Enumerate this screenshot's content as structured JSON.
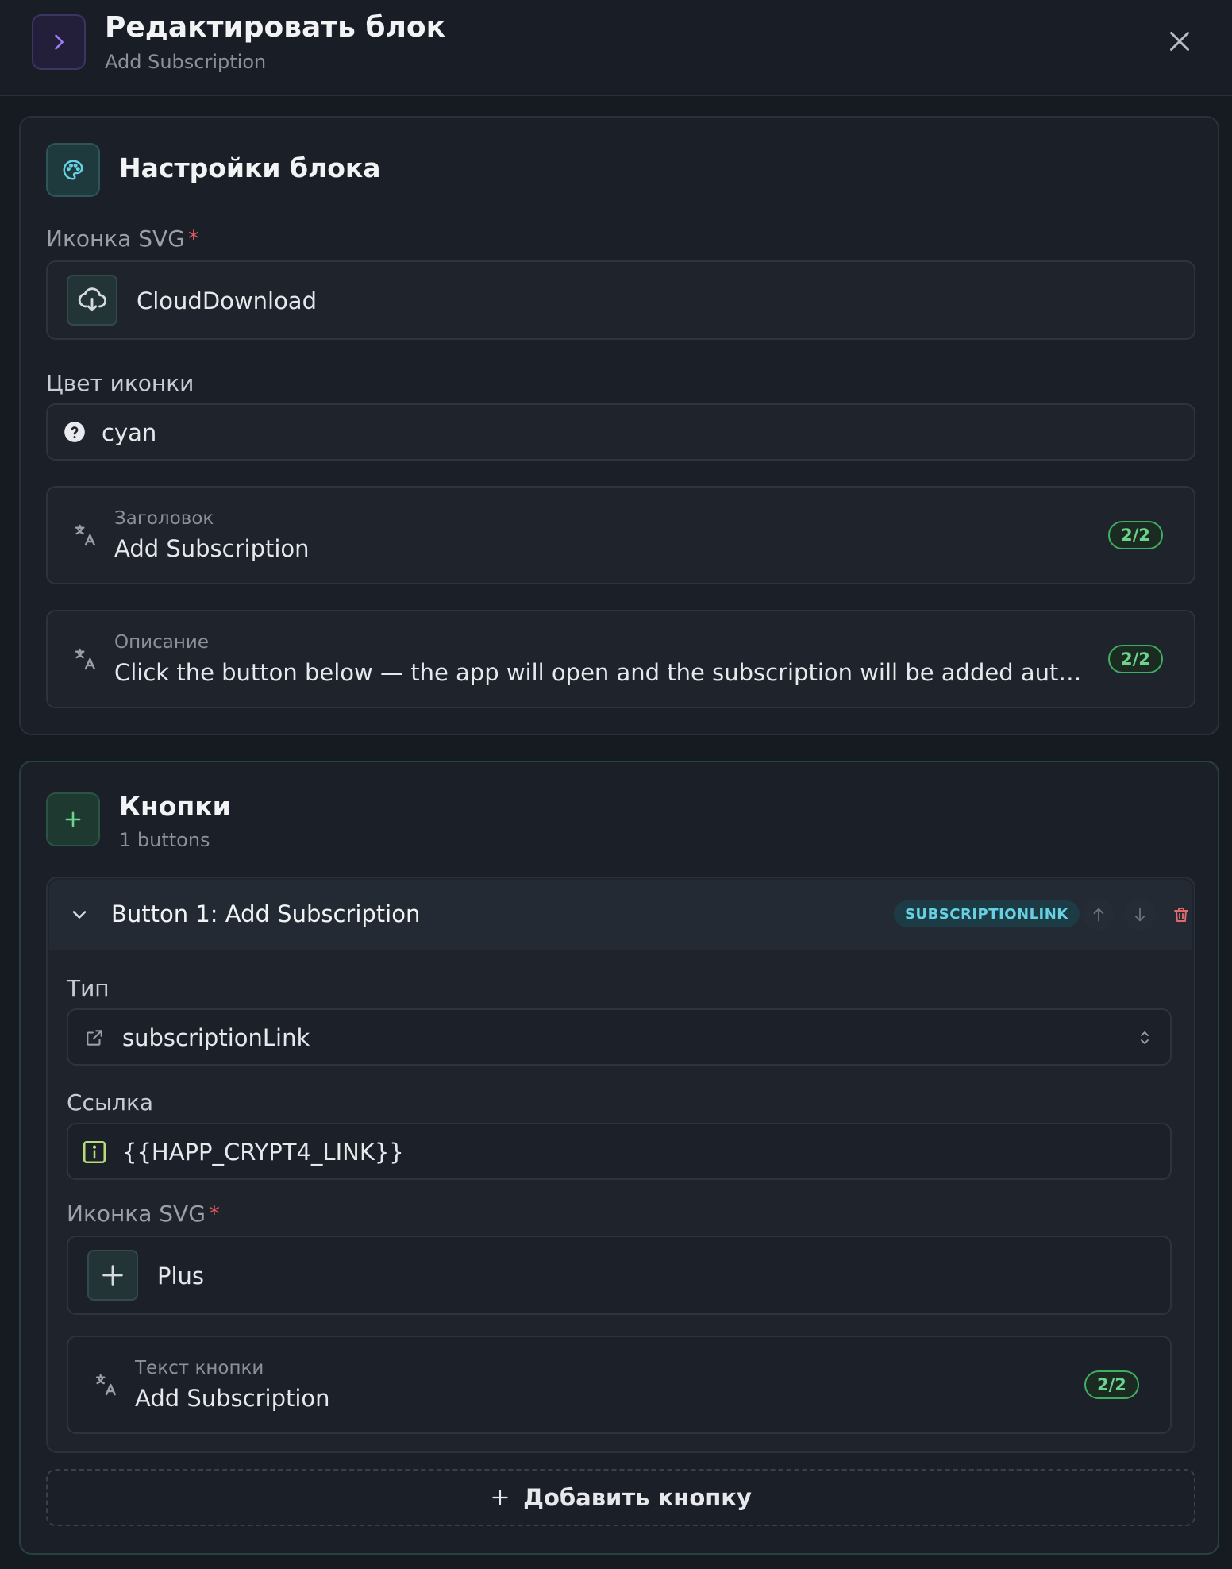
{
  "header": {
    "title": "Редактировать блок",
    "subtitle": "Add Subscription"
  },
  "block_settings": {
    "title": "Настройки блока",
    "icon_label": "Иконка SVG",
    "required_mark": "*",
    "icon_value": "CloudDownload",
    "color_label": "Цвет иконки",
    "color_value": "cyan",
    "heading": {
      "label": "Заголовок",
      "value": "Add Subscription",
      "badge": "2/2"
    },
    "description": {
      "label": "Описание",
      "value": "Click the button below — the app will open and the subscription will be added autom...",
      "badge": "2/2"
    }
  },
  "buttons_section": {
    "title": "Кнопки",
    "count_label": "1 buttons",
    "items": [
      {
        "header": "Button 1: Add Subscription",
        "type_badge": "SUBSCRIPTIONLINK",
        "type_label": "Тип",
        "type_value": "subscriptionLink",
        "link_label": "Ссылка",
        "link_value": "{{HAPP_CRYPT4_LINK}}",
        "icon_label": "Иконка SVG",
        "required_mark": "*",
        "icon_value": "Plus",
        "text": {
          "label": "Текст кнопки",
          "value": "Add Subscription",
          "badge": "2/2"
        }
      }
    ],
    "add_button_label": "Добавить кнопку"
  },
  "colors": {
    "accent_purple": "#8b6cf0",
    "accent_cyan": "#67d0e2",
    "accent_green": "#6bd38d",
    "required_red": "#e25c5c"
  },
  "icons": [
    "chevron-right-icon",
    "close-icon",
    "palette-icon",
    "cloud-download-icon",
    "help-circle-icon",
    "translate-icon",
    "plus-icon",
    "chevron-down-icon",
    "arrow-up-icon",
    "arrow-down-icon",
    "trash-icon",
    "external-link-icon",
    "chevron-up-down-icon",
    "info-icon"
  ]
}
